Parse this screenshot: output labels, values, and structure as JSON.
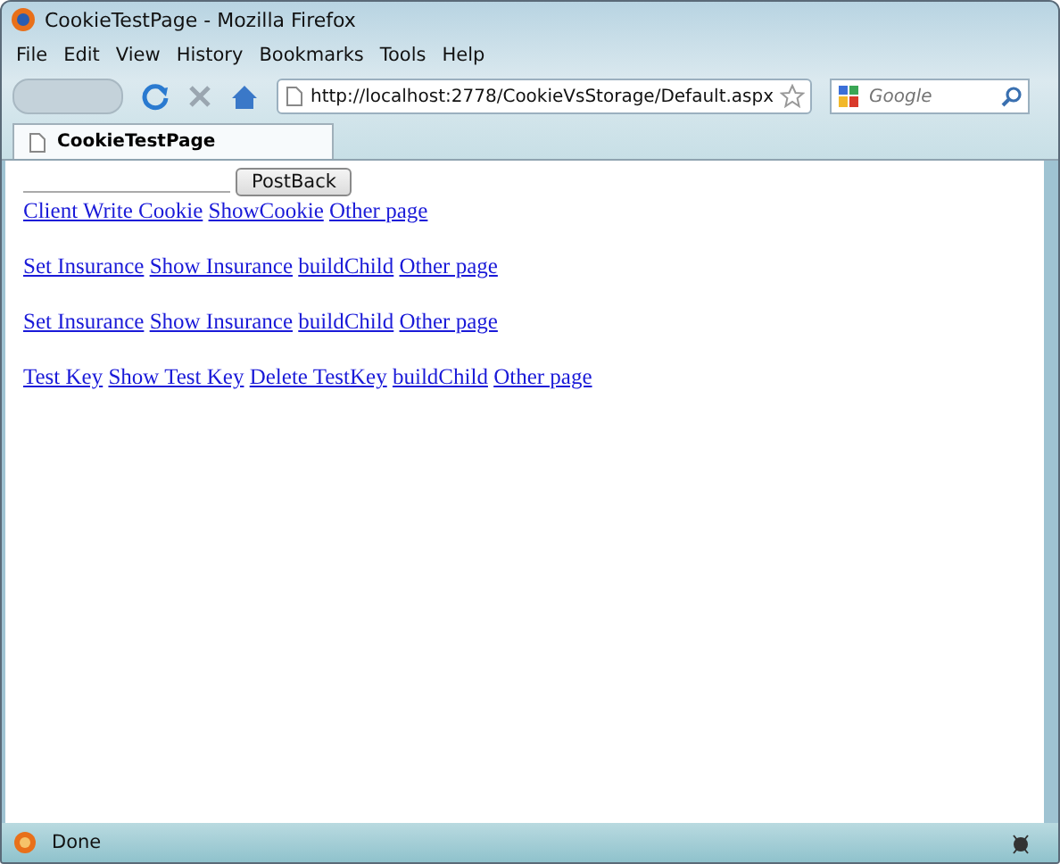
{
  "window": {
    "title": "CookieTestPage - Mozilla Firefox"
  },
  "menu": [
    "File",
    "Edit",
    "View",
    "History",
    "Bookmarks",
    "Tools",
    "Help"
  ],
  "address_bar": {
    "value": "http://localhost:2778/CookieVsStorage/Default.aspx"
  },
  "search": {
    "placeholder": "Google"
  },
  "tabs": [
    {
      "label": "CookieTestPage",
      "selected": true
    }
  ],
  "page": {
    "postback_button": "PostBack",
    "link_rows": [
      {
        "links": [
          "Client Write Cookie",
          "ShowCookie",
          "Other page"
        ]
      },
      {
        "links": [
          "Set Insurance",
          "Show Insurance",
          "buildChild",
          "Other page"
        ]
      },
      {
        "links": [
          "Set Insurance",
          "Show Insurance",
          "buildChild",
          "Other page"
        ]
      },
      {
        "links": [
          "Test Key",
          "Show Test Key",
          "Delete TestKey",
          "buildChild",
          "Other page"
        ]
      }
    ]
  },
  "status_bar": {
    "text": "Done"
  }
}
